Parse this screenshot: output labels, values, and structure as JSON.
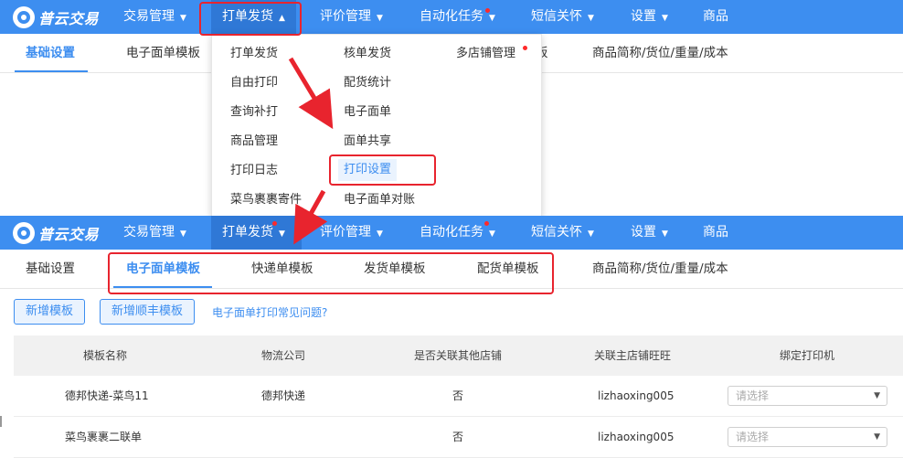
{
  "app": {
    "logo_text": "普云交易",
    "accent_color": "#3d8ef0",
    "highlight_color": "#e8242e"
  },
  "nav": {
    "items": [
      {
        "label": "交易管理",
        "chevron": "chevron-down-icon"
      },
      {
        "label": "打单发货",
        "chevron": "chevron-up-icon"
      },
      {
        "label": "评价管理",
        "chevron": "chevron-down-icon"
      },
      {
        "label": "自动化任务",
        "chevron": "chevron-down-icon"
      },
      {
        "label": "短信关怀",
        "chevron": "chevron-down-icon"
      },
      {
        "label": "设置",
        "chevron": "chevron-down-icon"
      },
      {
        "label": "商品"
      }
    ],
    "active": "打单发货"
  },
  "dropdown": {
    "col1": [
      "打单发货",
      "自由打印",
      "查询补打",
      "商品管理",
      "打印日志",
      "菜鸟裹裹寄件"
    ],
    "col2": [
      "核单发货",
      "配货统计",
      "电子面单",
      "面单共享",
      "打印设置",
      "电子面单对账"
    ],
    "col3": [
      "多店铺管理"
    ],
    "highlighted": "打印设置"
  },
  "subnav_top": {
    "items": [
      "基础设置",
      "电子面单模板",
      "商品简称/货位/重量/成本"
    ],
    "partial_text": "板",
    "active": "基础设置"
  },
  "subnav_bottom": {
    "items": [
      "基础设置",
      "电子面单模板",
      "快递单模板",
      "发货单模板",
      "配货单模板",
      "商品简称/货位/重量/成本"
    ],
    "active": "电子面单模板"
  },
  "toolbar": {
    "add_template": "新增模板",
    "add_sf_template": "新增顺丰模板",
    "faq_link": "电子面单打印常见问题?"
  },
  "table": {
    "columns": [
      "模板名称",
      "物流公司",
      "是否关联其他店铺",
      "关联主店铺旺旺",
      "绑定打印机"
    ],
    "rows": [
      {
        "name": "德邦快递-菜鸟11",
        "company": "德邦快递",
        "linked": "否",
        "wangwang": "lizhaoxing005",
        "printer_placeholder": "请选择"
      },
      {
        "name": "菜鸟裹裹二联单",
        "company": "",
        "linked": "否",
        "wangwang": "lizhaoxing005",
        "printer_placeholder": "请选择"
      }
    ]
  }
}
